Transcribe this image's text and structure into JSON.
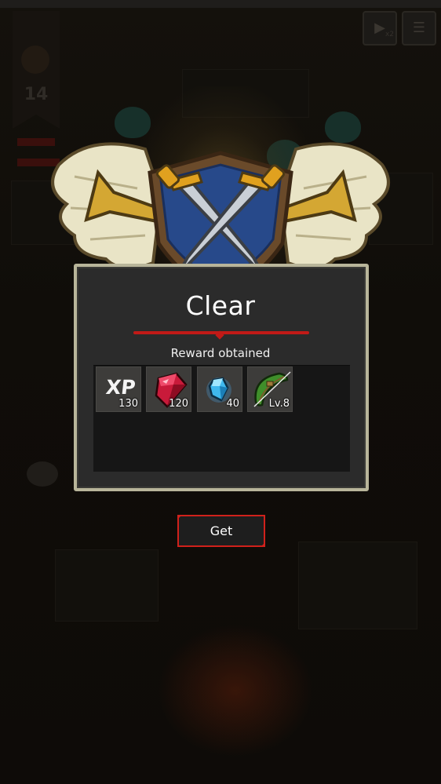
{
  "background": {
    "floor_number": "14",
    "speed_label": "x2",
    "speed_icon": "fast-forward-icon",
    "menu_icon": "menu-icon"
  },
  "result": {
    "title": "Clear",
    "reward_label": "Reward obtained",
    "emblem_icon": "crossed-swords-shield-icon"
  },
  "rewards": [
    {
      "name": "xp",
      "icon": "xp-icon",
      "label": "XP",
      "count": "130"
    },
    {
      "name": "red-gem",
      "icon": "red-gem-icon",
      "count": "120"
    },
    {
      "name": "blue-gem",
      "icon": "blue-gem-icon",
      "count": "40"
    },
    {
      "name": "bow",
      "icon": "bow-icon",
      "count": "Lv.8"
    }
  ],
  "actions": {
    "get_label": "Get"
  },
  "colors": {
    "accent_red": "#c11a17",
    "panel_border": "#b8b59a",
    "panel_bg": "#2b2b2b"
  }
}
